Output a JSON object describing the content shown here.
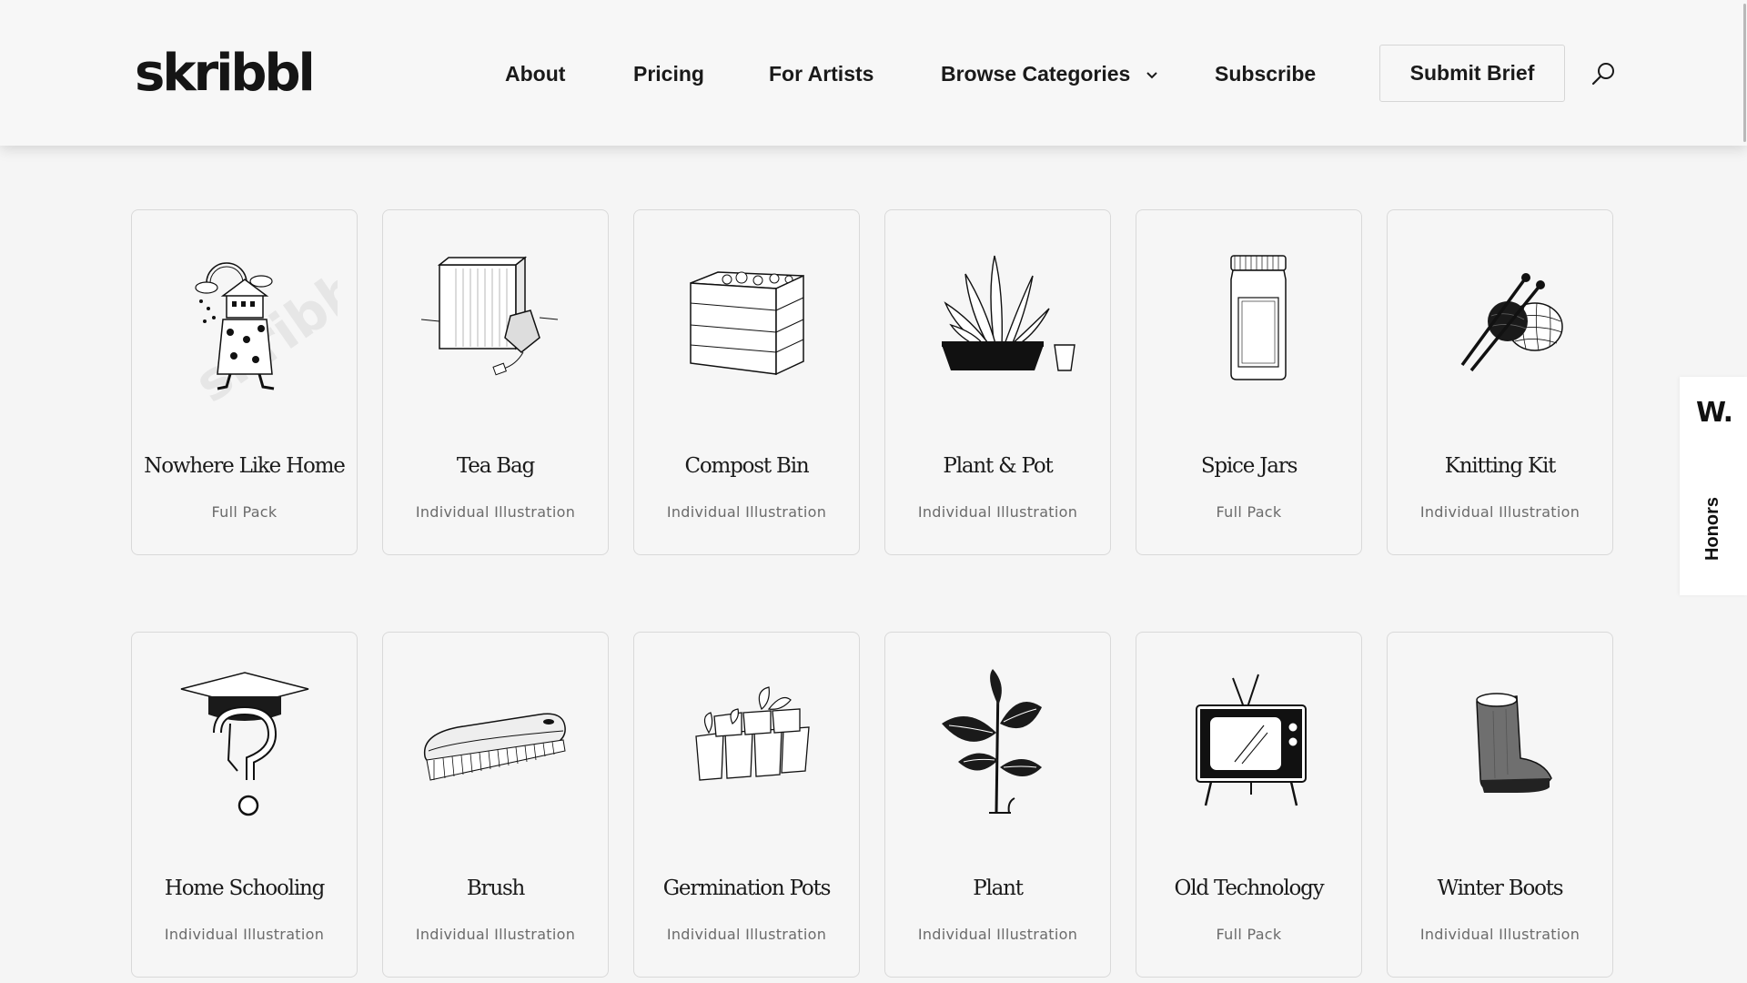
{
  "header": {
    "logo": "skribbl",
    "nav": [
      {
        "label": "About"
      },
      {
        "label": "Pricing"
      },
      {
        "label": "For Artists"
      },
      {
        "label": "Browse Categories"
      },
      {
        "label": "Subscribe"
      }
    ],
    "submit_brief": "Submit Brief",
    "search_icon": "search-icon",
    "dropdown_icon": "chevron-down-icon"
  },
  "products": [
    {
      "title": "Nowhere Like Home",
      "type": "Full Pack",
      "icon": "house-figure-illustration"
    },
    {
      "title": "Tea Bag",
      "type": "Individual Illustration",
      "icon": "tea-bag-illustration"
    },
    {
      "title": "Compost Bin",
      "type": "Individual Illustration",
      "icon": "compost-bin-illustration"
    },
    {
      "title": "Plant & Pot",
      "type": "Individual Illustration",
      "icon": "plant-pot-illustration"
    },
    {
      "title": "Spice Jars",
      "type": "Full Pack",
      "icon": "spice-jar-illustration"
    },
    {
      "title": "Knitting Kit",
      "type": "Individual Illustration",
      "icon": "knitting-kit-illustration"
    },
    {
      "title": "Home Schooling",
      "type": "Individual Illustration",
      "icon": "graduation-question-illustration"
    },
    {
      "title": "Brush",
      "type": "Individual Illustration",
      "icon": "brush-illustration"
    },
    {
      "title": "Germination Pots",
      "type": "Individual Illustration",
      "icon": "seedling-tray-illustration"
    },
    {
      "title": "Plant",
      "type": "Individual Illustration",
      "icon": "plant-illustration"
    },
    {
      "title": "Old Technology",
      "type": "Full Pack",
      "icon": "retro-tv-illustration"
    },
    {
      "title": "Winter Boots",
      "type": "Individual Illustration",
      "icon": "boot-illustration"
    }
  ],
  "honors_badge": {
    "mark": "W.",
    "label": "Honors"
  },
  "watermark": "skribbl",
  "colors": {
    "background": "#f5f5f5",
    "card_border": "#d9d9d9",
    "text": "#1a1a1a",
    "subtext": "#6b6b6b"
  }
}
